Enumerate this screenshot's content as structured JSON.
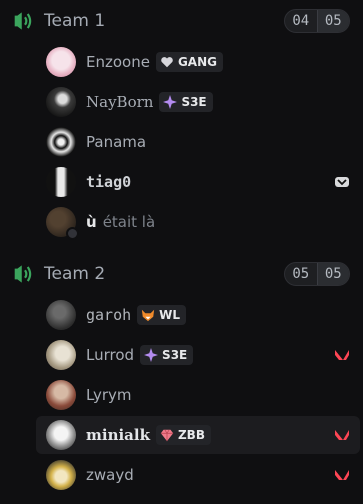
{
  "channels": [
    {
      "name": "Team 1",
      "count": "04",
      "limit": "05",
      "users": [
        {
          "name": "Enzoone",
          "tag": "GANG",
          "tag_icon": "heart-icon"
        },
        {
          "name": "NayBorn",
          "tag": "S3E",
          "tag_icon": "sparkle-icon"
        },
        {
          "name": "Panama"
        },
        {
          "name": "tiag0",
          "right_icon": "game-activity-icon"
        },
        {
          "name": "ù",
          "status": "était là"
        }
      ]
    },
    {
      "name": "Team 2",
      "count": "05",
      "limit": "05",
      "users": [
        {
          "name": "garoh",
          "tag": "WL",
          "tag_icon": "fox-icon"
        },
        {
          "name": "Lurrod",
          "tag": "S3E",
          "tag_icon": "sparkle-icon",
          "right_icon": "valorant-icon"
        },
        {
          "name": "Lyrym"
        },
        {
          "name": "minialk",
          "tag": "ZBB",
          "tag_icon": "gem-icon",
          "right_icon": "valorant-icon"
        },
        {
          "name": "zwayd",
          "right_icon": "valorant-icon"
        }
      ]
    }
  ],
  "colors": {
    "voice_icon": "#3ba55d",
    "valorant": "#ff4655",
    "background": "#0f0f11"
  }
}
